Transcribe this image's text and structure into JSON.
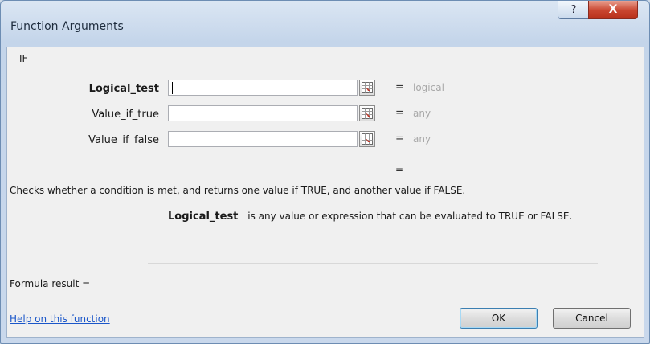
{
  "window": {
    "title": "Function Arguments",
    "help_glyph": "?",
    "close_glyph": "X"
  },
  "function": {
    "name": "IF",
    "arguments": [
      {
        "label": "Logical_test",
        "value": "",
        "evaluated": "logical",
        "bold": true,
        "focused": true
      },
      {
        "label": "Value_if_true",
        "value": "",
        "evaluated": "any",
        "bold": false,
        "focused": false
      },
      {
        "label": "Value_if_false",
        "value": "",
        "evaluated": "any",
        "bold": false,
        "focused": false
      }
    ],
    "equals_sign": "=",
    "result_equals": "=",
    "description": "Checks whether a condition is met, and returns one value if TRUE, and another value if FALSE.",
    "argument_description_name": "Logical_test",
    "argument_description_text": "is any value or expression that can be evaluated to TRUE or FALSE."
  },
  "footer": {
    "formula_result_label": "Formula result =",
    "help_link": "Help on this function",
    "ok_label": "OK",
    "cancel_label": "Cancel"
  },
  "icons": {
    "range_select": "collapse-dialog-icon"
  }
}
